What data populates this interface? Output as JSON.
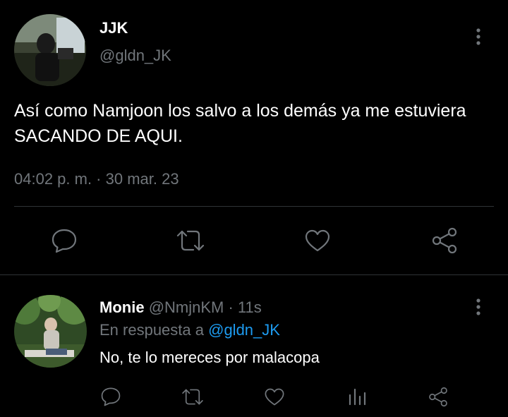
{
  "main_tweet": {
    "author_name": "JJK",
    "author_handle": "@gldn_JK",
    "text": "Así como Namjoon los salvo a los demás ya me estuviera SACANDO DE AQUI.",
    "timestamp": "04:02 p. m. · 30 mar. 23",
    "actions": [
      "reply-icon",
      "retweet-icon",
      "like-icon",
      "share-icon"
    ]
  },
  "reply_tweet": {
    "author_name": "Monie",
    "author_handle": "@NmjnKM",
    "separator": "·",
    "time_ago": "11s",
    "reply_prefix": "En respuesta a",
    "reply_to": "@gldn_JK",
    "text": "No, te lo mereces por malacopa",
    "actions": [
      "reply-icon",
      "retweet-icon",
      "like-icon",
      "views-icon",
      "share-icon"
    ]
  },
  "colors": {
    "background": "#000000",
    "primary_text": "#ffffff",
    "secondary_text": "#71767b",
    "link": "#1d9bf0",
    "divider": "#2f3336"
  }
}
